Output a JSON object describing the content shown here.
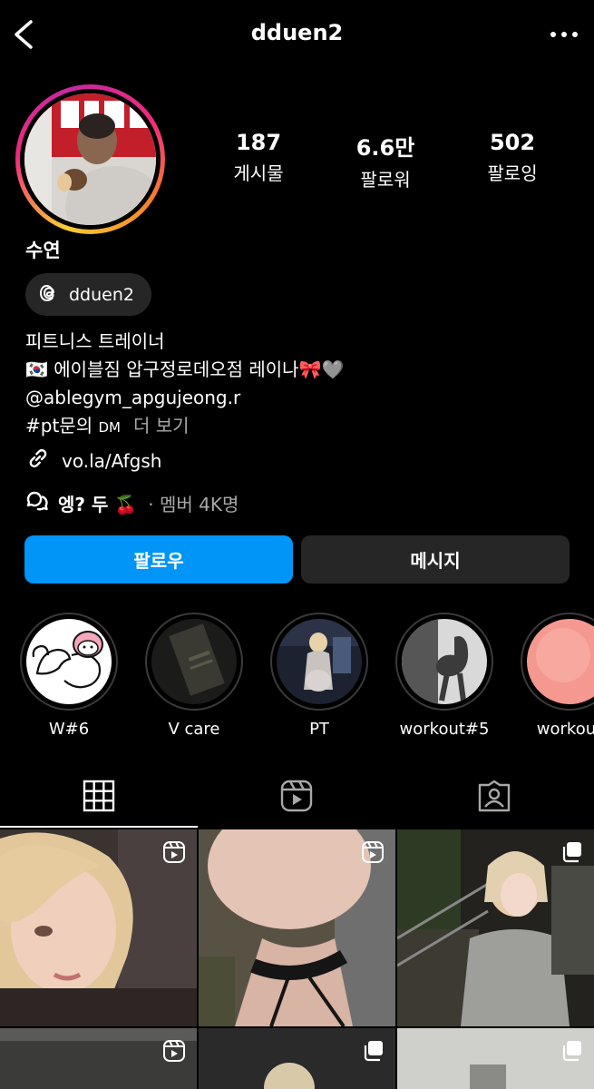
{
  "header": {
    "username": "dduen2"
  },
  "profile": {
    "display_name": "수연",
    "stats": [
      {
        "value": "187",
        "label": "게시물"
      },
      {
        "value": "6.6만",
        "label": "팔로워"
      },
      {
        "value": "502",
        "label": "팔로잉"
      }
    ],
    "threads_handle": "dduen2",
    "bio": {
      "line1": "피트니스 트레이너",
      "line2_flag": "🇰🇷",
      "line2": "에이블짐 압구정로데오점 레이나🎀🩶",
      "line3": "@ablegym_apgujeong.r",
      "line4": "#pt문의",
      "line4_dm": "DM",
      "more": "더 보기"
    },
    "link": "vo.la/Afgsh",
    "channel": {
      "name": "엥? 두 🍒",
      "members": "· 멤버 4K명"
    }
  },
  "actions": {
    "follow_label": "팔로우",
    "message_label": "메시지"
  },
  "highlights": [
    {
      "label": "W#6"
    },
    {
      "label": "V care"
    },
    {
      "label": "PT"
    },
    {
      "label": "workout#5"
    },
    {
      "label": "workout"
    }
  ],
  "tabs": {
    "active": "grid"
  }
}
